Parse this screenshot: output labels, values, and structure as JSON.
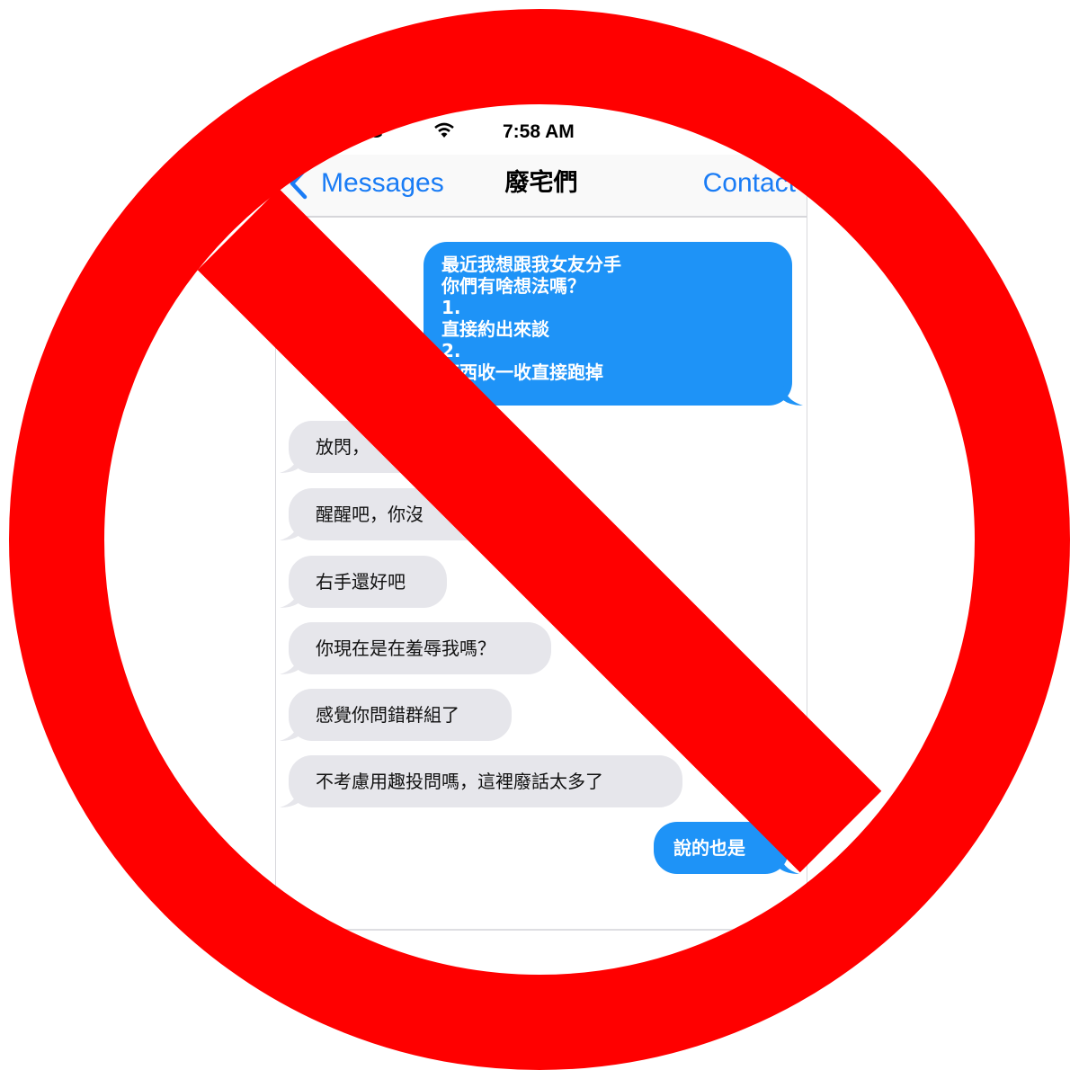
{
  "status": {
    "carrier": "&T 3G",
    "time": "7:58 AM"
  },
  "nav": {
    "back_label": "Messages",
    "title": "廢宅們",
    "contact_label": "Contact"
  },
  "messages": [
    {
      "direction": "out",
      "text": "最近我想跟我女友分手\n你們有啥想法嗎？\n1.\n直接約出來談\n2.\n東西收一收直接跑掉"
    },
    {
      "direction": "in",
      "text": "放閃，"
    },
    {
      "direction": "in",
      "text": "醒醒吧，你沒"
    },
    {
      "direction": "in",
      "text": "右手還好吧"
    },
    {
      "direction": "in",
      "text": "你現在是在羞辱我嗎？"
    },
    {
      "direction": "in",
      "text": "感覺你問錯群組了"
    },
    {
      "direction": "in",
      "text": "不考慮用趣投問嗎，這裡廢話太多了"
    },
    {
      "direction": "out",
      "text": "說的也是"
    }
  ],
  "colors": {
    "sign_red": "#ff0000",
    "imessage_blue": "#1e93f7",
    "bubble_gray": "#e6e6eb",
    "link_blue": "#1a7cf5"
  },
  "icons": {
    "back": "chevron-left-icon",
    "wifi": "wifi-icon",
    "sign": "prohibition-sign-icon"
  }
}
